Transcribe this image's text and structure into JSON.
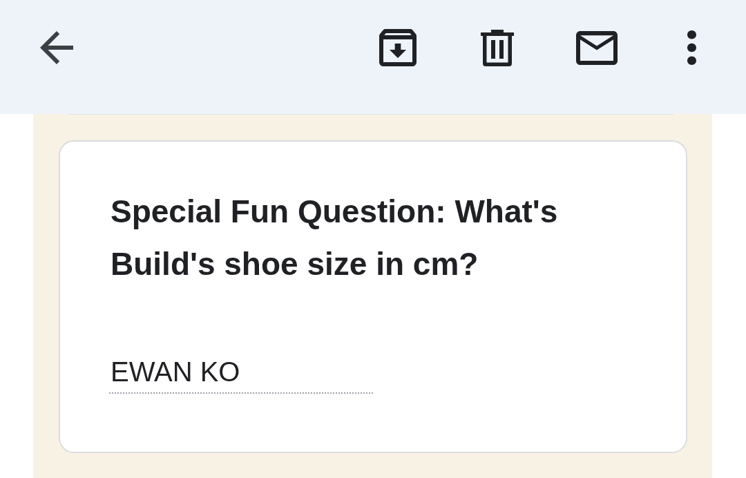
{
  "toolbar": {
    "leading": {
      "kind": "back"
    },
    "actions": [
      {
        "kind": "archive"
      },
      {
        "kind": "trash"
      },
      {
        "kind": "mail"
      },
      {
        "kind": "more"
      }
    ]
  },
  "question": {
    "title": "Special Fun Question: What's Build's shoe size in cm?",
    "answer": {
      "value": "EWAN KO"
    }
  }
}
